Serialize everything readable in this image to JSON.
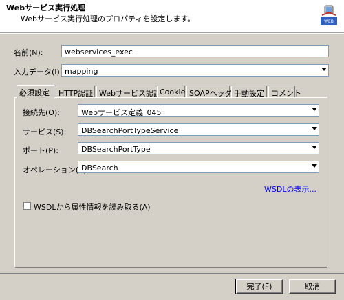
{
  "header": {
    "title": "Webサービス実行処理",
    "subtitle": "Webサービス実行処理のプロパティを設定します。",
    "icon": "web-service-icon"
  },
  "form": {
    "name_label": "名前(N):",
    "name_value": "webservices_exec",
    "input_data_label": "入力データ(I):",
    "input_data_value": "mapping"
  },
  "tabs": [
    {
      "label": "必須設定",
      "active": true
    },
    {
      "label": "HTTP認証"
    },
    {
      "label": "Webサービス認証"
    },
    {
      "label": "Cookie"
    },
    {
      "label": "SOAPヘッダ"
    },
    {
      "label": "手動設定"
    },
    {
      "label": "コメント"
    }
  ],
  "panel": {
    "connection_label": "接続先(O):",
    "connection_value": "Webサービス定義_045",
    "service_label": "サービス(S):",
    "service_value": "DBSearchPortTypeService",
    "port_label": "ポート(P):",
    "port_value": "DBSearchPortType",
    "operation_label": "オペレーション(E):",
    "operation_value": "DBSearch",
    "wsdl_link": "WSDLの表示...",
    "read_attrs_label": "WSDLから属性情報を読み取る(A)"
  },
  "buttons": {
    "finish": "完了(F)",
    "cancel": "取消"
  }
}
